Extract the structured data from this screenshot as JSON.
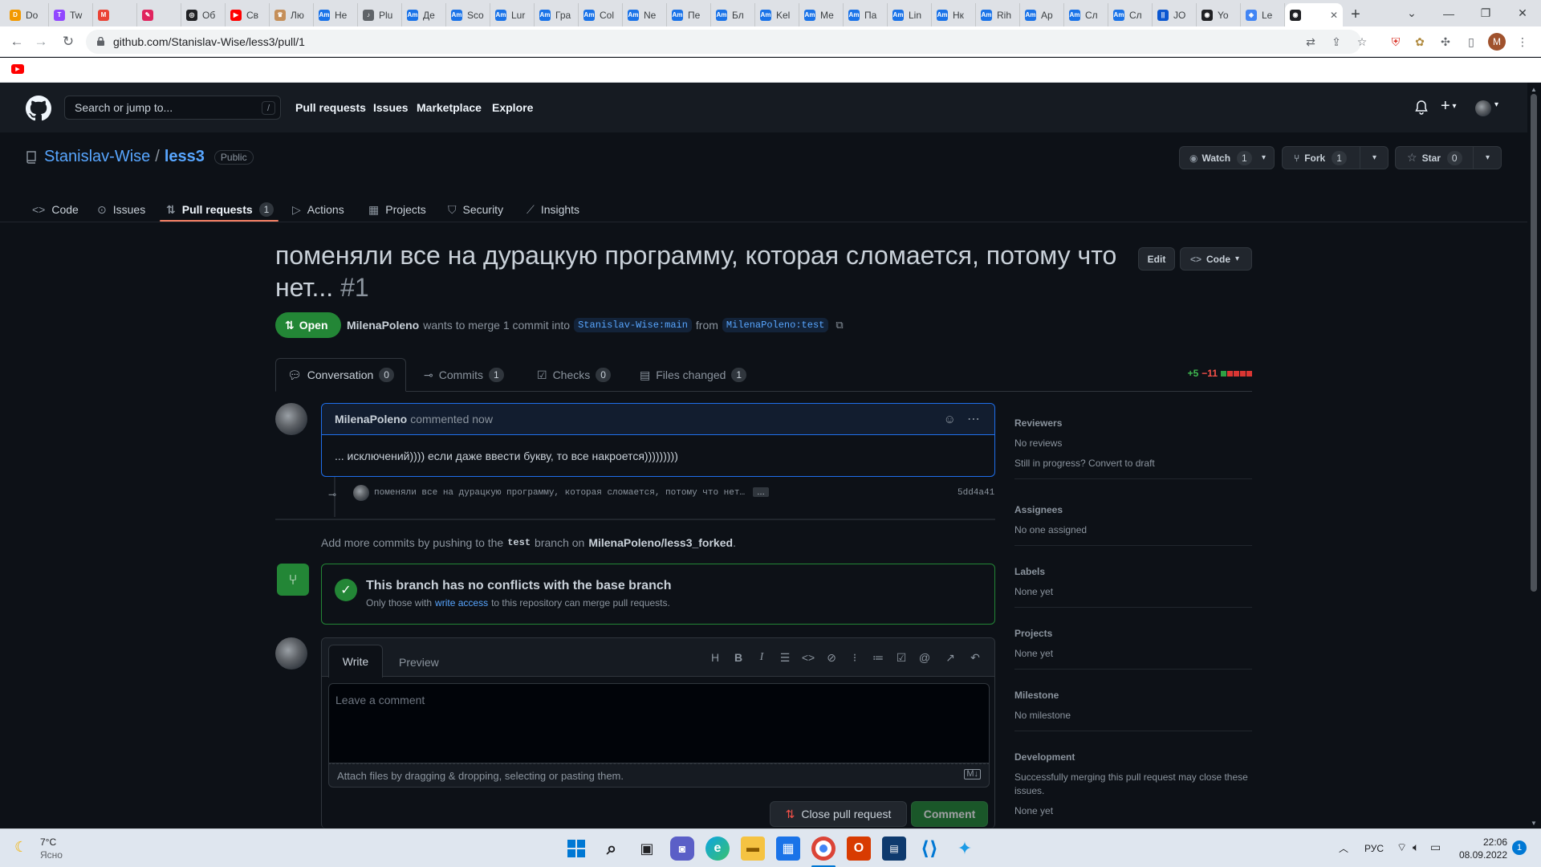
{
  "browser": {
    "tabs": [
      {
        "label": "Do",
        "color": "#f29900",
        "glyph": "D"
      },
      {
        "label": "Tw",
        "color": "#9146ff",
        "glyph": "T"
      },
      {
        "label": "",
        "color": "#ea4335",
        "glyph": "M"
      },
      {
        "label": "",
        "color": "#e0245e",
        "glyph": "✎"
      },
      {
        "label": "Об",
        "color": "#202124",
        "glyph": "◎"
      },
      {
        "label": "Св",
        "color": "#ff0000",
        "glyph": "▶"
      },
      {
        "label": "Лю",
        "color": "#c58f5a",
        "glyph": "♛"
      },
      {
        "label": "Не",
        "color": "#1a73e8",
        "glyph": "Am"
      },
      {
        "label": "Plu",
        "color": "#5f6368",
        "glyph": "♪"
      },
      {
        "label": "Де",
        "color": "#1a73e8",
        "glyph": "Am"
      },
      {
        "label": "Sco",
        "color": "#1a73e8",
        "glyph": "Am"
      },
      {
        "label": "Lur",
        "color": "#1a73e8",
        "glyph": "Am"
      },
      {
        "label": "Гра",
        "color": "#1a73e8",
        "glyph": "Am"
      },
      {
        "label": "Col",
        "color": "#1a73e8",
        "glyph": "Am"
      },
      {
        "label": "Ne",
        "color": "#1a73e8",
        "glyph": "Am"
      },
      {
        "label": "Пе",
        "color": "#1a73e8",
        "glyph": "Am"
      },
      {
        "label": "Бл",
        "color": "#1a73e8",
        "glyph": "Am"
      },
      {
        "label": "Kel",
        "color": "#1a73e8",
        "glyph": "Am"
      },
      {
        "label": "Ме",
        "color": "#1a73e8",
        "glyph": "Am"
      },
      {
        "label": "Па",
        "color": "#1a73e8",
        "glyph": "Am"
      },
      {
        "label": "Lin",
        "color": "#1a73e8",
        "glyph": "Am"
      },
      {
        "label": "Нк",
        "color": "#1a73e8",
        "glyph": "Am"
      },
      {
        "label": "Rih",
        "color": "#1a73e8",
        "glyph": "Am"
      },
      {
        "label": "Ap",
        "color": "#1a73e8",
        "glyph": "Am"
      },
      {
        "label": "Сл",
        "color": "#1a73e8",
        "glyph": "Am"
      },
      {
        "label": "Сл",
        "color": "#1a73e8",
        "glyph": "Am"
      },
      {
        "label": "JO",
        "color": "#0b57d0",
        "glyph": "||"
      },
      {
        "label": "Yo",
        "color": "#202124",
        "glyph": "◉"
      },
      {
        "label": "Le",
        "color": "#4285f4",
        "glyph": "◈"
      }
    ],
    "active_tab_glyph": "◉",
    "url": "github.com/Stanislav-Wise/less3/pull/1",
    "profile_initial": "M",
    "ext_badge": "4"
  },
  "gh": {
    "search_placeholder": "Search or jump to...",
    "search_key": "/",
    "nav": [
      "Pull requests",
      "Issues",
      "Marketplace",
      "Explore"
    ],
    "owner": "Stanislav-Wise",
    "sep": "/",
    "repo": "less3",
    "visibility": "Public",
    "watch": {
      "label": "Watch",
      "count": "1"
    },
    "fork": {
      "label": "Fork",
      "count": "1"
    },
    "star": {
      "label": "Star",
      "count": "0"
    },
    "repo_tabs": [
      {
        "label": "Code",
        "icon": "code-icon",
        "count": null
      },
      {
        "label": "Issues",
        "icon": "issue-icon",
        "count": null
      },
      {
        "label": "Pull requests",
        "icon": "pull-request-icon",
        "count": "1"
      },
      {
        "label": "Actions",
        "icon": "play-icon",
        "count": null
      },
      {
        "label": "Projects",
        "icon": "table-icon",
        "count": null
      },
      {
        "label": "Security",
        "icon": "shield-icon",
        "count": null
      },
      {
        "label": "Insights",
        "icon": "graph-icon",
        "count": null
      }
    ]
  },
  "pr": {
    "title_line1": "поменяли все на дурацкую программу, которая сломается, потому что",
    "title_line2": "нет...",
    "number": "#1",
    "edit": "Edit",
    "code": "Code",
    "state": "Open",
    "author": "MilenaPoleno",
    "merge_text": "wants to merge 1 commit into",
    "base": "Stanislav-Wise:main",
    "from": "from",
    "head": "MilenaPoleno:test",
    "tabs": [
      {
        "label": "Conversation",
        "count": "0"
      },
      {
        "label": "Commits",
        "count": "1"
      },
      {
        "label": "Checks",
        "count": "0"
      },
      {
        "label": "Files changed",
        "count": "1"
      }
    ],
    "additions": "+5",
    "deletions": "−11",
    "diffstat": [
      "#2ea043",
      "#da3633",
      "#da3633",
      "#da3633",
      "#da3633"
    ]
  },
  "comment": {
    "author": "MilenaPoleno",
    "meta": "commented now",
    "body": "... исключений)))) если даже ввести букву, то все накроется)))))))))"
  },
  "commit": {
    "message": "поменяли все на дурацкую программу, которая сломается, потому что нет…",
    "ellipsis": "…",
    "sha": "5dd4a41"
  },
  "push_hint": {
    "pre": "Add more commits by pushing to the",
    "branch": "test",
    "mid": "branch on",
    "repo": "MilenaPoleno/less3_forked",
    "end": "."
  },
  "merge_box": {
    "title": "This branch has no conflicts with the base branch",
    "pre": "Only those with",
    "link": "write access",
    "post": "to this repository can merge pull requests."
  },
  "editor": {
    "write": "Write",
    "preview": "Preview",
    "placeholder": "Leave a comment",
    "attach": "Attach files by dragging & dropping, selecting or pasting them.",
    "close_pr": "Close pull request",
    "comment": "Comment"
  },
  "sidebar": [
    {
      "header": "Reviewers",
      "lines": [
        "No reviews",
        "Still in progress? Convert to draft"
      ]
    },
    {
      "header": "Assignees",
      "lines": [
        "No one assigned"
      ]
    },
    {
      "header": "Labels",
      "lines": [
        "None yet"
      ]
    },
    {
      "header": "Projects",
      "lines": [
        "None yet"
      ]
    },
    {
      "header": "Milestone",
      "lines": [
        "No milestone"
      ]
    },
    {
      "header": "Development",
      "lines": [
        "Successfully merging this pull request may close these issues.",
        "None yet"
      ]
    }
  ],
  "taskbar": {
    "temp": "7°C",
    "weather": "Ясно",
    "lang": "РУС",
    "time": "22:06",
    "date": "08.09.2022",
    "notif": "1"
  }
}
